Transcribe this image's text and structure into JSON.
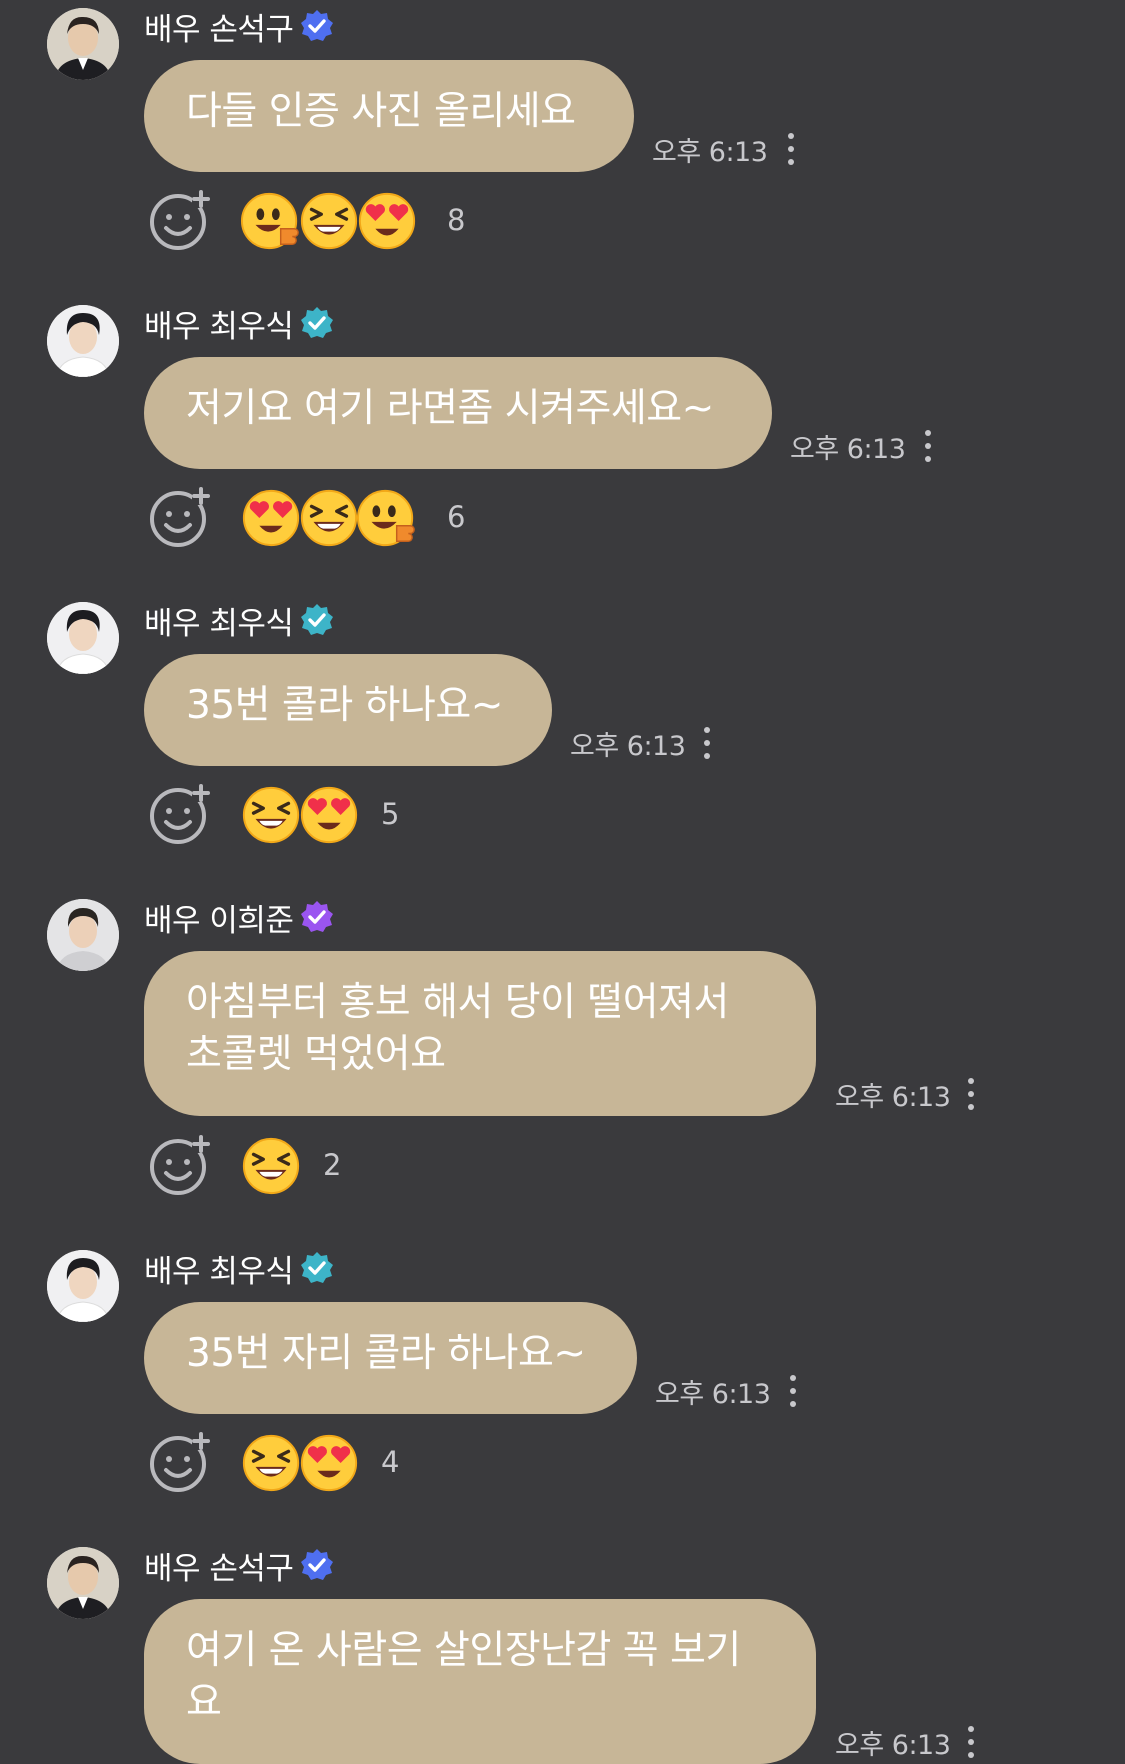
{
  "colors": {
    "background": "#3a3a3d",
    "bubble": "#c7b697",
    "muted_text": "#c8c8cc",
    "verified_blue": "#4f6ff0",
    "verified_teal": "#3db4c8",
    "verified_purple": "#9a55f0"
  },
  "messages": [
    {
      "sender": "배우 손석구",
      "verified_color": "blue",
      "text_lines": [
        "다들 인증 사진 올리세요"
      ],
      "time": "오후 6:13",
      "reactions": [
        "thumbs-up-face-emoji",
        "grinning-squint-face-emoji",
        "heart-eyes-face-emoji"
      ],
      "reaction_count": "8"
    },
    {
      "sender": "배우 최우식",
      "verified_color": "teal",
      "text_lines": [
        "저기요 여기 라면좀 시켜주세요~"
      ],
      "time": "오후 6:13",
      "reactions": [
        "heart-eyes-face-emoji",
        "grinning-squint-face-emoji",
        "thumbs-up-face-emoji"
      ],
      "reaction_count": "6"
    },
    {
      "sender": "배우 최우식",
      "verified_color": "teal",
      "text_lines": [
        "35번 콜라 하나요~"
      ],
      "time": "오후 6:13",
      "reactions": [
        "grinning-squint-face-emoji",
        "heart-eyes-face-emoji"
      ],
      "reaction_count": "5"
    },
    {
      "sender": "배우 이희준",
      "verified_color": "purple",
      "text_lines": [
        "아침부터 홍보 해서 당이 떨어져서",
        "초콜렛 먹었어요"
      ],
      "time": "오후 6:13",
      "reactions": [
        "grinning-squint-face-emoji"
      ],
      "reaction_count": "2"
    },
    {
      "sender": "배우 최우식",
      "verified_color": "teal",
      "text_lines": [
        "35번 자리 콜라 하나요~"
      ],
      "time": "오후 6:13",
      "reactions": [
        "grinning-squint-face-emoji",
        "heart-eyes-face-emoji"
      ],
      "reaction_count": "4"
    },
    {
      "sender": "배우 손석구",
      "verified_color": "blue",
      "text_lines": [
        "여기 온 사람은 살인장난감 꼭 보기",
        "요"
      ],
      "time": "오후 6:13",
      "reactions": [],
      "reaction_count": ""
    }
  ]
}
